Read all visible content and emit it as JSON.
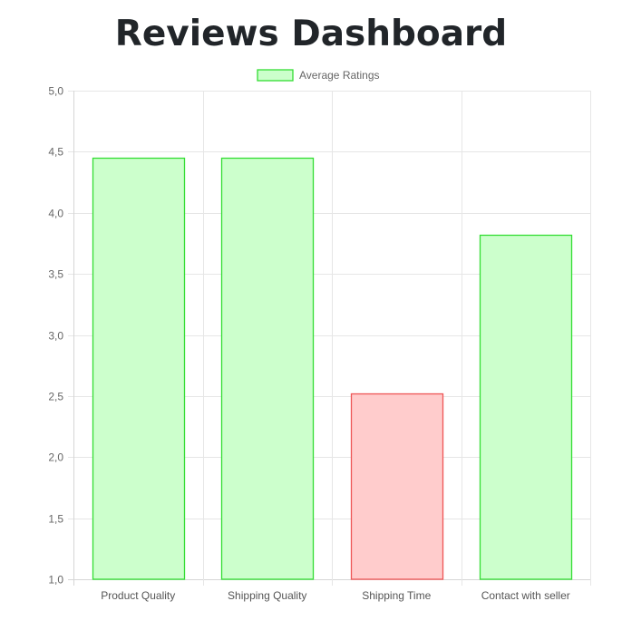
{
  "page": {
    "title": "Reviews Dashboard"
  },
  "chart_data": {
    "type": "bar",
    "categories": [
      "Product Quality",
      "Shipping Quality",
      "Shipping Time",
      "Contact with seller"
    ],
    "series": [
      {
        "name": "Average Ratings",
        "values": [
          4.45,
          4.45,
          2.52,
          3.82
        ]
      }
    ],
    "bar_fill_colors": [
      "#ccffcc",
      "#ccffcc",
      "#ffcccc",
      "#ccffcc"
    ],
    "bar_border_colors": [
      "#33dd33",
      "#33dd33",
      "#ee5555",
      "#33dd33"
    ],
    "legend_swatch_fill": "#ccffcc",
    "legend_swatch_border": "#33dd33",
    "ylim": [
      1.0,
      5.0
    ],
    "y_ticks": [
      "1,0",
      "1,5",
      "2,0",
      "2,5",
      "3,0",
      "3,5",
      "4,0",
      "4,5",
      "5,0"
    ],
    "legend_position": "top-center",
    "grid": true
  }
}
